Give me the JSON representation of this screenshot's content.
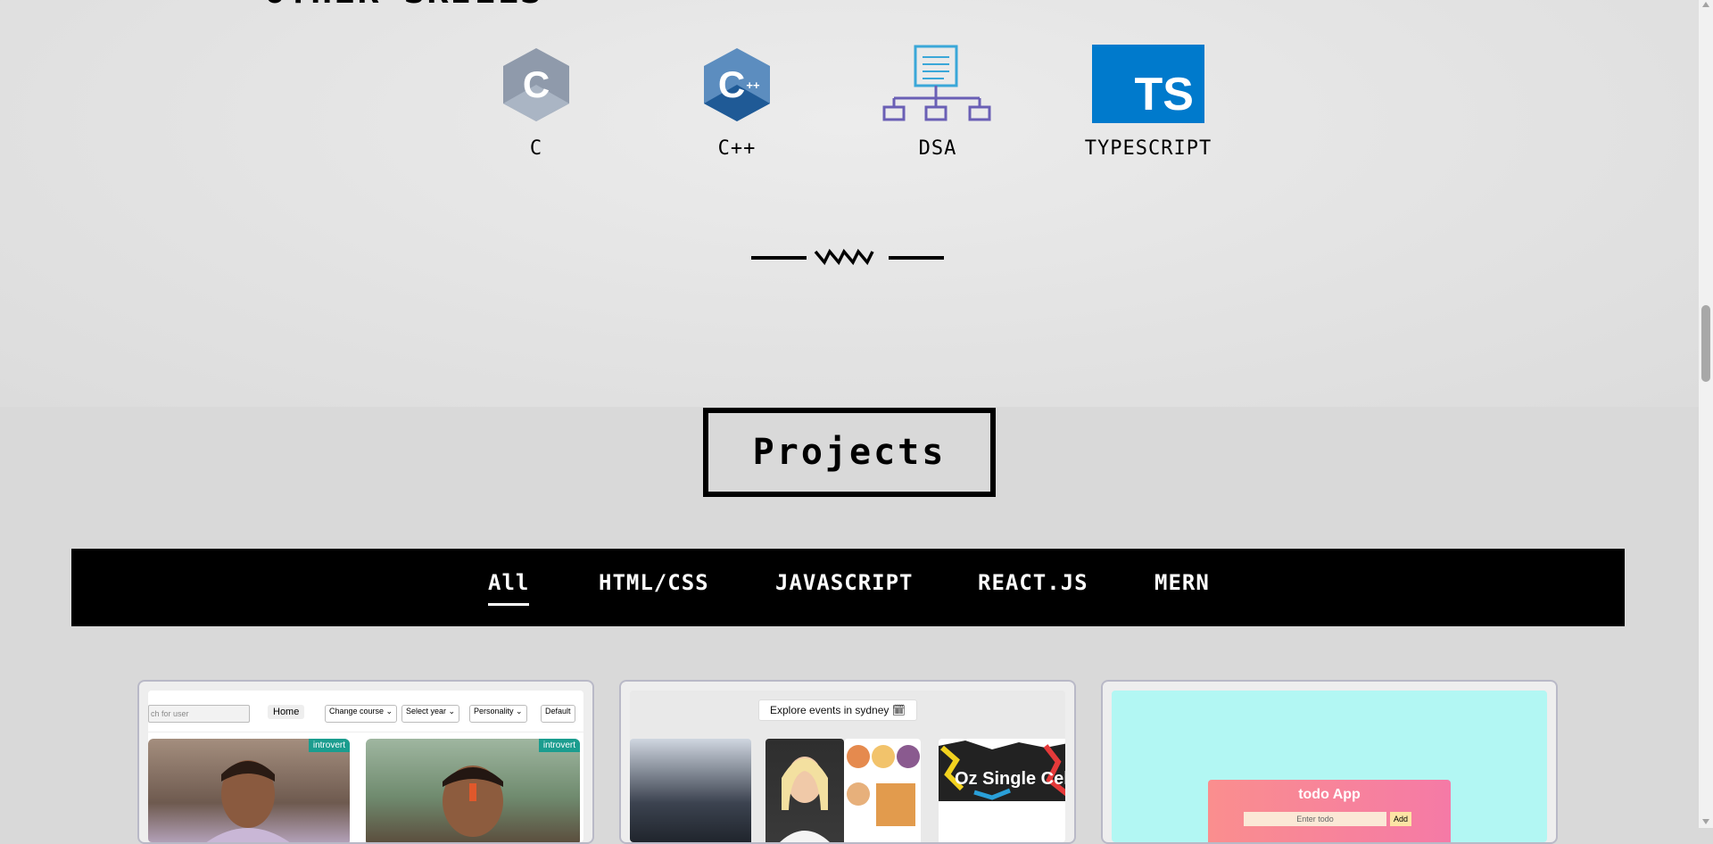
{
  "skills": {
    "heading": "OTHER SKILLS",
    "items": [
      {
        "name": "C",
        "icon": "c-language-icon"
      },
      {
        "name": "C++",
        "icon": "cpp-language-icon"
      },
      {
        "name": "DSA",
        "icon": "dsa-tree-icon"
      },
      {
        "name": "TYPESCRIPT",
        "icon": "typescript-icon",
        "logo_text": "TS"
      }
    ]
  },
  "projects": {
    "title": "Projects",
    "filters": [
      {
        "label": "All",
        "active": true
      },
      {
        "label": "HTML/CSS"
      },
      {
        "label": "JAVASCRIPT"
      },
      {
        "label": "REACT.JS"
      },
      {
        "label": "MERN"
      }
    ],
    "cards": [
      {
        "search_placeholder": "ch for user",
        "home_label": "Home",
        "selects": [
          "Change course ⌄",
          "Select year ⌄",
          "Personality ⌄",
          "Default"
        ],
        "badges": [
          "introvert",
          "introvert"
        ]
      },
      {
        "explore_label": "Explore events in sydney 🗓",
        "banner_text": "Oz Single Cel"
      },
      {
        "todo_title": "todo App",
        "todo_placeholder": "Enter todo",
        "todo_add": "Add"
      }
    ]
  },
  "colors": {
    "filter_bar": "#000000",
    "badge": "#1b9d8f",
    "typescript": "#007acc",
    "todo_bg": "#b2f7f3"
  }
}
